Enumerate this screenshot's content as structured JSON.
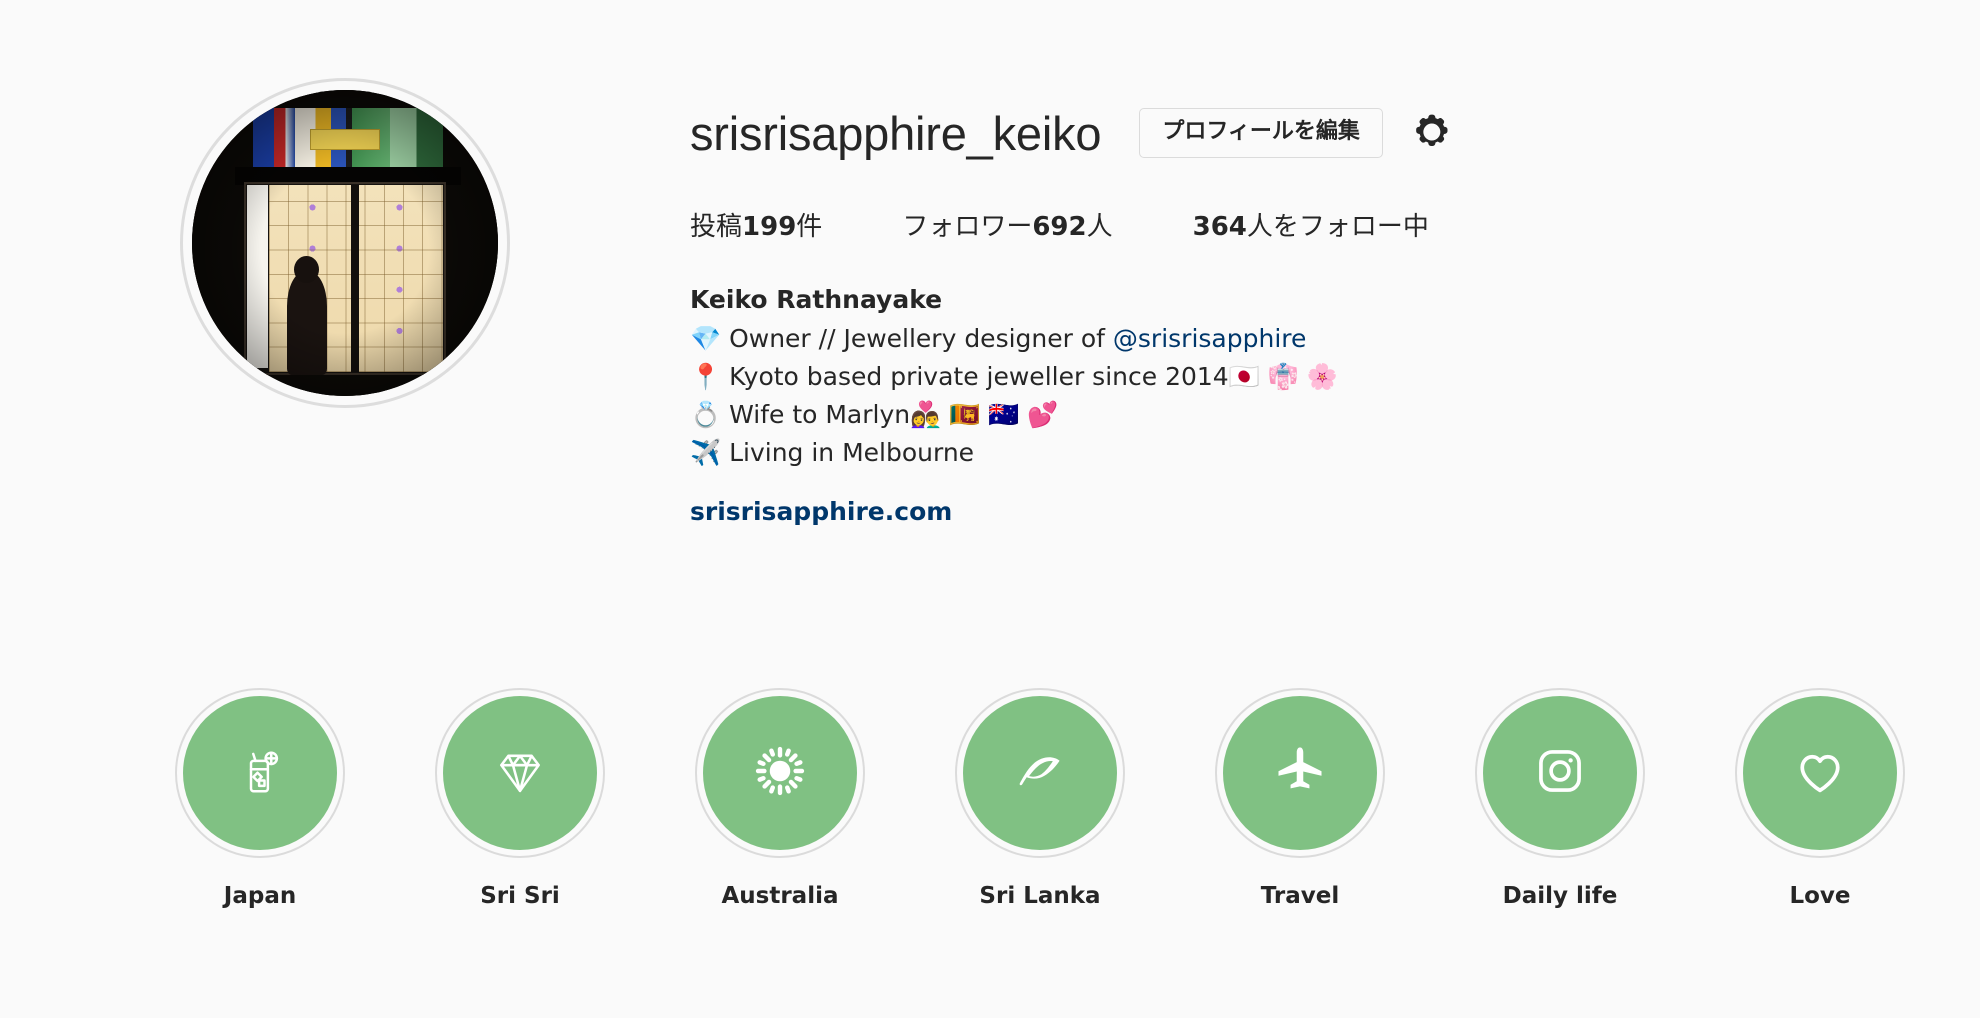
{
  "profile": {
    "username": "srisrisapphire_keiko",
    "edit_profile_label": "プロフィールを編集",
    "settings_icon": "gear-icon",
    "avatar_alt": "profile-photo-stained-glass-doorway",
    "stats": [
      {
        "label_prefix": "投稿",
        "value": "199",
        "label_suffix": "件",
        "name": "posts"
      },
      {
        "label_prefix": "フォロワー",
        "value": "692",
        "label_suffix": "人",
        "name": "followers"
      },
      {
        "label_prefix": "",
        "value": "364",
        "label_suffix": "人をフォロー中",
        "name": "following"
      }
    ],
    "full_name": "Keiko Rathnayake",
    "bio_lines": [
      {
        "text": "💎 Owner // Jewellery designer of ",
        "mention": "@srisrisapphire"
      },
      {
        "text": "📍 Kyoto based private jeweller since 2014🇯🇵 👘 🌸",
        "mention": ""
      },
      {
        "text": "💍 Wife to Marlyn👩‍❤️‍👨 🇱🇰 🇦🇺 💕",
        "mention": ""
      },
      {
        "text": "✈️ Living in Melbourne",
        "mention": ""
      }
    ],
    "website": "srisrisapphire.com"
  },
  "highlights": [
    {
      "label": "Japan",
      "icon": "cocktail-drink-icon"
    },
    {
      "label": "Sri Sri",
      "icon": "diamond-icon"
    },
    {
      "label": "Australia",
      "icon": "sun-icon"
    },
    {
      "label": "Sri Lanka",
      "icon": "leaf-icon"
    },
    {
      "label": "Travel",
      "icon": "airplane-icon"
    },
    {
      "label": "Daily life",
      "icon": "instagram-camera-icon"
    },
    {
      "label": "Love",
      "icon": "heart-icon"
    }
  ],
  "colors": {
    "background": "#fafafa",
    "text": "#262626",
    "link": "#00376b",
    "highlight_green": "#80c183",
    "border": "#dbdbdb"
  }
}
